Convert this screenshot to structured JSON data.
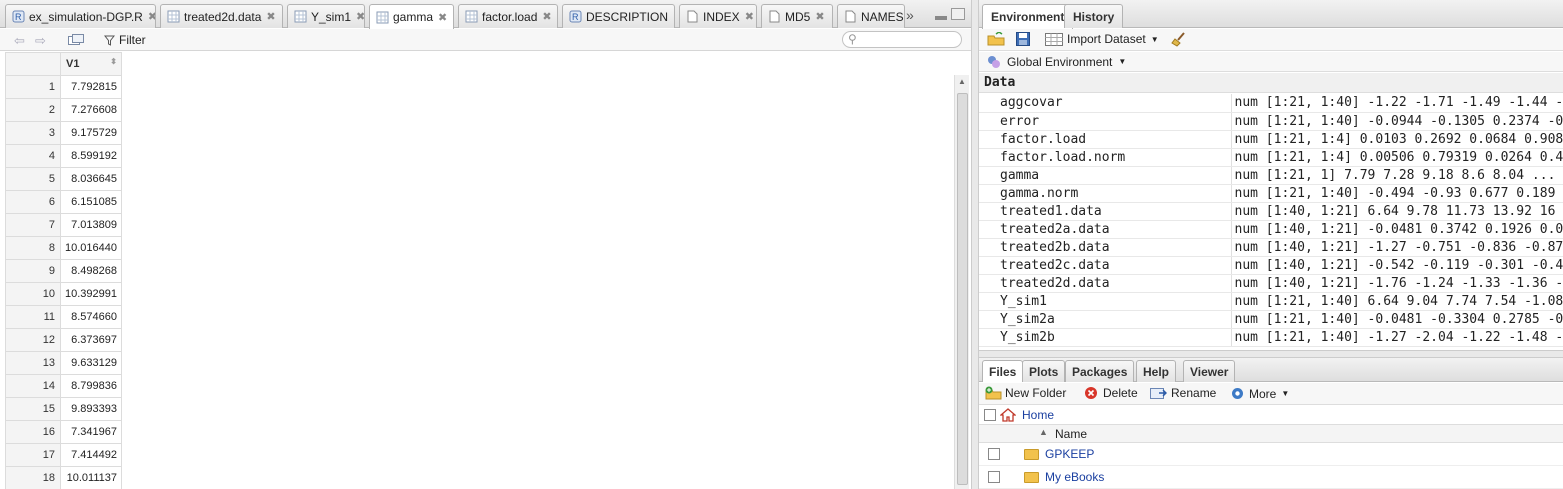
{
  "editor": {
    "tabs": [
      {
        "label": "ex_simulation-DGP.R",
        "icon": "r-file-icon",
        "active": false
      },
      {
        "label": "treated2d.data",
        "icon": "table-icon",
        "active": false
      },
      {
        "label": "Y_sim1",
        "icon": "table-icon",
        "active": false
      },
      {
        "label": "gamma",
        "icon": "table-icon",
        "active": true
      },
      {
        "label": "factor.load",
        "icon": "table-icon",
        "active": false
      },
      {
        "label": "DESCRIPTION",
        "icon": "r-file-icon",
        "active": false
      },
      {
        "label": "INDEX",
        "icon": "document-icon",
        "active": false
      },
      {
        "label": "MD5",
        "icon": "document-icon",
        "active": false
      },
      {
        "label": "NAMESP",
        "icon": "document-icon",
        "active": false
      }
    ],
    "tab_overflow": "»",
    "filter_label": "Filter",
    "search_placeholder": "",
    "grid": {
      "column_header": "V1",
      "rows": [
        {
          "n": "1",
          "v": "7.792815"
        },
        {
          "n": "2",
          "v": "7.276608"
        },
        {
          "n": "3",
          "v": "9.175729"
        },
        {
          "n": "4",
          "v": "8.599192"
        },
        {
          "n": "5",
          "v": "8.036645"
        },
        {
          "n": "6",
          "v": "6.151085"
        },
        {
          "n": "7",
          "v": "7.013809"
        },
        {
          "n": "8",
          "v": "10.016440"
        },
        {
          "n": "9",
          "v": "8.498268"
        },
        {
          "n": "10",
          "v": "10.392991"
        },
        {
          "n": "11",
          "v": "8.574660"
        },
        {
          "n": "12",
          "v": "6.373697"
        },
        {
          "n": "13",
          "v": "9.633129"
        },
        {
          "n": "14",
          "v": "8.799836"
        },
        {
          "n": "15",
          "v": "9.893393"
        },
        {
          "n": "16",
          "v": "7.341967"
        },
        {
          "n": "17",
          "v": "7.414492"
        },
        {
          "n": "18",
          "v": "10.011137"
        }
      ]
    }
  },
  "environment": {
    "tabs": [
      "Environment",
      "History"
    ],
    "import_dataset_label": "Import Dataset",
    "global_env_label": "Global Environment",
    "section_header": "Data",
    "items": [
      {
        "name": "aggcovar",
        "value": "num [1:21, 1:40] -1.22 -1.71 -1.49 -1.44 -"
      },
      {
        "name": "error",
        "value": "num [1:21, 1:40] -0.0944 -0.1305 0.2374 -0"
      },
      {
        "name": "factor.load",
        "value": "num [1:21, 1:4] 0.0103 0.2692 0.0684 0.908"
      },
      {
        "name": "factor.load.norm",
        "value": "num [1:21, 1:4] 0.00506 0.79319 0.0264 0.4"
      },
      {
        "name": "gamma",
        "value": "num [1:21, 1] 7.79 7.28 9.18 8.6 8.04 ..."
      },
      {
        "name": "gamma.norm",
        "value": "num [1:21, 1:40] -0.494 -0.93 0.677 0.189"
      },
      {
        "name": "treated1.data",
        "value": "num [1:40, 1:21] 6.64 9.78 11.73 13.92 16"
      },
      {
        "name": "treated2a.data",
        "value": "num [1:40, 1:21] -0.0481 0.3742 0.1926 0.0"
      },
      {
        "name": "treated2b.data",
        "value": "num [1:40, 1:21] -1.27 -0.751 -0.836 -0.87"
      },
      {
        "name": "treated2c.data",
        "value": "num [1:40, 1:21] -0.542 -0.119 -0.301 -0.4"
      },
      {
        "name": "treated2d.data",
        "value": "num [1:40, 1:21] -1.76 -1.24 -1.33 -1.36 -"
      },
      {
        "name": "Y_sim1",
        "value": "num [1:21, 1:40] 6.64 9.04 7.74 7.54 -1.08"
      },
      {
        "name": "Y_sim2a",
        "value": "num [1:21, 1:40] -0.0481 -0.3304 0.2785 -0"
      },
      {
        "name": "Y_sim2b",
        "value": "num [1:21, 1:40] -1.27 -2.04 -1.22 -1.48 -"
      }
    ]
  },
  "files": {
    "tabs": [
      "Files",
      "Plots",
      "Packages",
      "Help",
      "Viewer"
    ],
    "toolbar": {
      "new_folder": "New Folder",
      "delete": "Delete",
      "rename": "Rename",
      "more": "More"
    },
    "path": "Home",
    "name_header": "Name",
    "entries": [
      {
        "name": "GPKEEP"
      },
      {
        "name": "My eBooks"
      }
    ]
  },
  "colors": {
    "link": "#1a3fa0",
    "folder": "#f2c24c"
  }
}
